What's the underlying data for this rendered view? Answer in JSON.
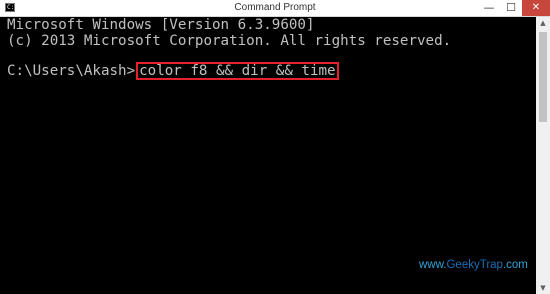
{
  "window": {
    "title": "Command Prompt",
    "icon_label": "C:\\",
    "controls": {
      "minimize": "—",
      "maximize": "☐",
      "close": "✕"
    }
  },
  "console": {
    "line1": "Microsoft Windows [Version 6.3.9600]",
    "line2": "(c) 2013 Microsoft Corporation. All rights reserved.",
    "prompt": "C:\\Users\\Akash>",
    "command": "color f8 && dir && time",
    "text_color": "#c0c0c0",
    "background": "#000000",
    "highlight_color": "#e8202a"
  },
  "watermark": {
    "prefix": "www.",
    "brand": "GeekyTrap",
    "suffix": ".com"
  }
}
